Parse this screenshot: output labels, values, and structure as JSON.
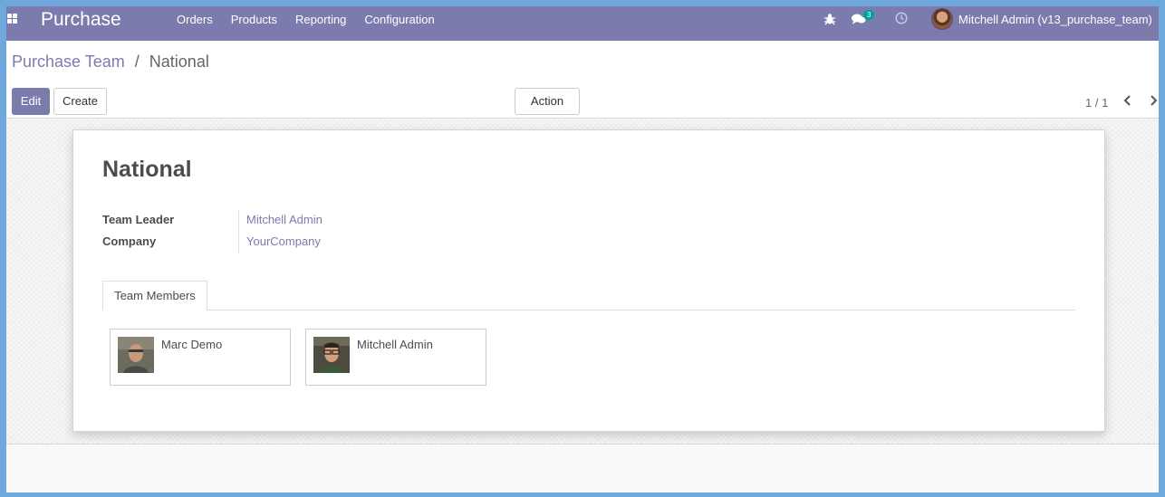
{
  "navbar": {
    "brand": "Purchase",
    "menu": [
      "Orders",
      "Products",
      "Reporting",
      "Configuration"
    ],
    "chat_badge": "3",
    "user": "Mitchell Admin (v13_purchase_team)"
  },
  "breadcrumb": {
    "parent": "Purchase Team",
    "separator": "/",
    "current": "National"
  },
  "buttons": {
    "edit": "Edit",
    "create": "Create",
    "action": "Action"
  },
  "pager": "1 / 1",
  "record": {
    "title": "National",
    "fields": [
      {
        "label": "Team Leader",
        "value": "Mitchell Admin"
      },
      {
        "label": "Company",
        "value": "YourCompany"
      }
    ]
  },
  "tabs": [
    "Team Members"
  ],
  "members": [
    {
      "name": "Marc Demo"
    },
    {
      "name": "Mitchell Admin"
    }
  ],
  "colors": {
    "brand": "#7c7bad",
    "frame": "#6ea8dc",
    "badge": "#00a09d"
  }
}
